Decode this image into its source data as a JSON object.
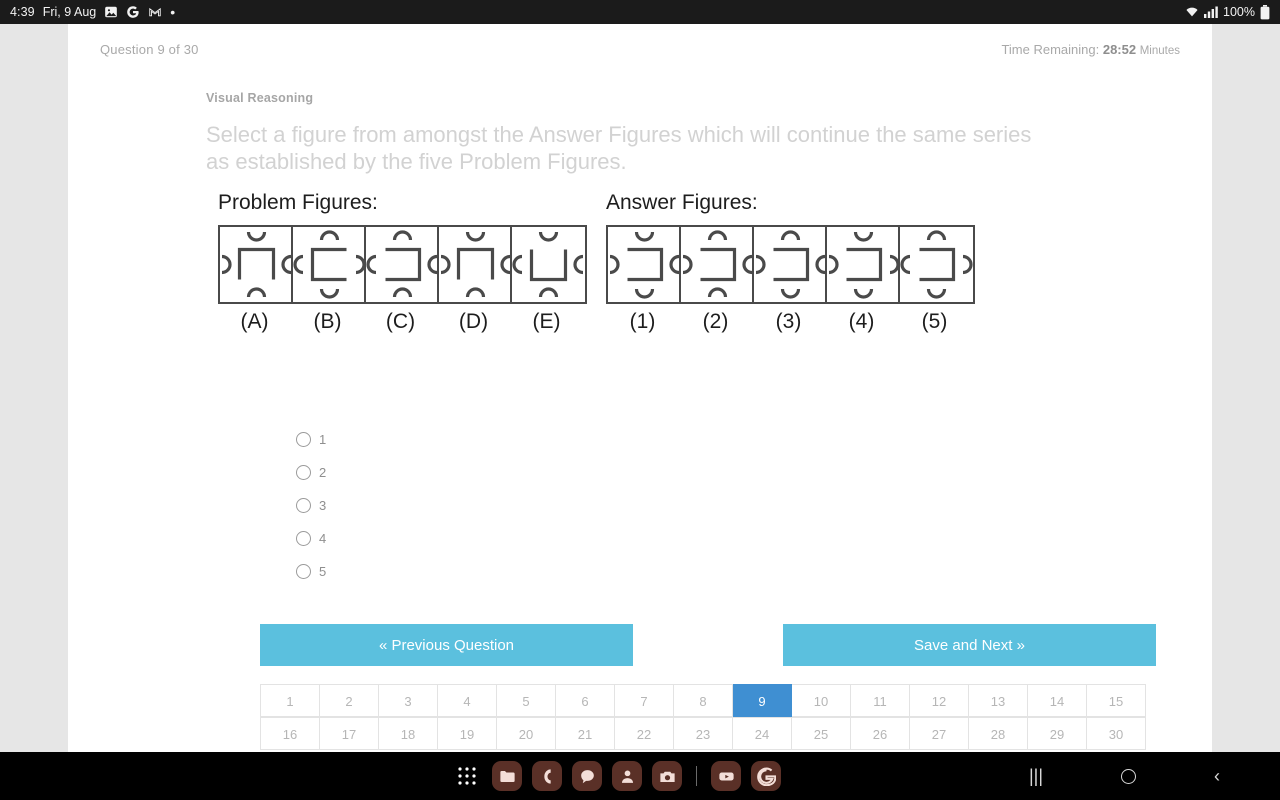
{
  "status_bar": {
    "time": "4:39",
    "date": "Fri, 9 Aug",
    "icons": [
      "photos-icon",
      "google-icon",
      "gmail-icon",
      "more-dot-icon"
    ],
    "wifi_icon": "wifi-icon",
    "signal_icon": "cellular-signal-icon",
    "battery_text": "100%",
    "battery_icon": "battery-full-icon"
  },
  "quiz": {
    "question_counter": "Question 9 of 30",
    "timer_prefix": "Time Remaining:",
    "timer_value": "28:52",
    "timer_units": "Minutes",
    "section": "Visual Reasoning",
    "prompt": "Select a figure from amongst the Answer Figures which will continue the same series as established by the five Problem Figures.",
    "problem_title": "Problem Figures:",
    "answer_title": "Answer Figures:",
    "problem_labels": [
      "(A)",
      "(B)",
      "(C)",
      "(D)",
      "(E)"
    ],
    "answer_labels": [
      "(1)",
      "(2)",
      "(3)",
      "(4)",
      "(5)"
    ],
    "problem_figures": [
      {
        "center": "cap",
        "top": "down",
        "bottom": "up",
        "left": "right",
        "right": "left"
      },
      {
        "center": "left",
        "top": "up",
        "bottom": "down",
        "left": "left",
        "right": "right"
      },
      {
        "center": "right",
        "top": "up",
        "bottom": "up",
        "left": "left",
        "right": "left"
      },
      {
        "center": "cap",
        "top": "down",
        "bottom": "up",
        "left": "right",
        "right": "left"
      },
      {
        "center": "cup",
        "top": "down",
        "bottom": "up",
        "left": "left",
        "right": "left"
      }
    ],
    "answer_figures": [
      {
        "center": "right",
        "top": "down",
        "bottom": "down",
        "left": "right",
        "right": "left"
      },
      {
        "center": "right",
        "top": "up",
        "bottom": "up",
        "left": "right",
        "right": "left"
      },
      {
        "center": "right",
        "top": "up",
        "bottom": "down",
        "left": "right",
        "right": "left"
      },
      {
        "center": "right",
        "top": "down",
        "bottom": "down",
        "left": "right",
        "right": "right"
      },
      {
        "center": "right",
        "top": "up",
        "bottom": "down",
        "left": "left",
        "right": "right"
      }
    ],
    "options": [
      "1",
      "2",
      "3",
      "4",
      "5"
    ],
    "selected_option": null,
    "prev_button": "« Previous Question",
    "next_button": "Save and Next »",
    "question_numbers_row1": [
      "1",
      "2",
      "3",
      "4",
      "5",
      "6",
      "7",
      "8",
      "9",
      "10",
      "11",
      "12",
      "13",
      "14",
      "15"
    ],
    "question_numbers_row2": [
      "16",
      "17",
      "18",
      "19",
      "20",
      "21",
      "22",
      "23",
      "24",
      "25",
      "26",
      "27",
      "28",
      "29",
      "30"
    ],
    "current_question": "9",
    "colors": {
      "button": "#5bc0de",
      "active_question": "#3f8fd2",
      "figure_stroke": "#4a4a4a"
    }
  },
  "nav_bar": {
    "dock_icons": [
      "app-drawer-icon",
      "folder-icon",
      "phone-icon",
      "messages-icon",
      "contacts-icon",
      "camera-icon",
      "divider",
      "youtube-icon",
      "google-icon"
    ],
    "recents_icon": "recents-icon",
    "home_icon": "home-icon",
    "back_icon": "back-icon"
  }
}
